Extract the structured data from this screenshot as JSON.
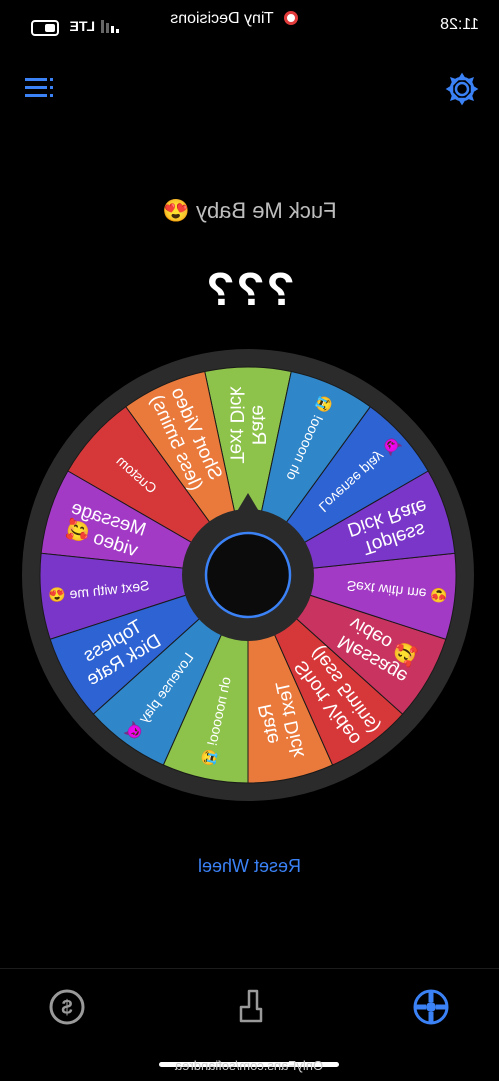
{
  "status_bar": {
    "time": "11:28",
    "app_name": "Tiny Decisions",
    "network": "LTE"
  },
  "header": {
    "menu_icon": "list-icon",
    "settings_icon": "gear-icon",
    "accent_color": "#3b82f6"
  },
  "main": {
    "subtitle": "Fuck Me Baby 😍",
    "result": "???",
    "reset_label": "Reset Wheel"
  },
  "wheel": {
    "segments": [
      {
        "label": "Rate\nText Dick",
        "color": "#8dc34a"
      },
      {
        "label": "Short Video\n(less 5mins)",
        "color": "#ea7a3c"
      },
      {
        "label": "Custom",
        "color": "#d6383a"
      },
      {
        "label": "Message\nvideo 🥰",
        "color": "#a33ac6"
      },
      {
        "label": "Sext with me 😍",
        "color": "#7a36c8"
      },
      {
        "label": "Topless\nDick Rate",
        "color": "#2d63d3"
      },
      {
        "label": "Lovense play 😈",
        "color": "#2f86c9"
      },
      {
        "label": "oh nooooo! 😭",
        "color": "#8dc34a"
      },
      {
        "label": "Rate\nText Dick",
        "color": "#ea7a3c"
      },
      {
        "label": "Short Video\n(less 5mins)",
        "color": "#d6383a"
      },
      {
        "label": "Message\nvideo 🥰",
        "color": "#c8335f"
      },
      {
        "label": "Sext with me 😍",
        "color": "#a33ac6"
      },
      {
        "label": "Topless\nDick Rate",
        "color": "#7a36c8"
      },
      {
        "label": "Lovense play 😈",
        "color": "#2d63d3"
      },
      {
        "label": "oh nooooo! 😭",
        "color": "#2f86c9"
      }
    ]
  },
  "tab_bar": {
    "tabs": [
      {
        "icon": "dollar-coin-icon"
      },
      {
        "icon": "hand-pointer-icon"
      },
      {
        "icon": "wheel-icon",
        "active": true
      }
    ]
  },
  "watermark": "OnlyFans.com/sofiandrea"
}
